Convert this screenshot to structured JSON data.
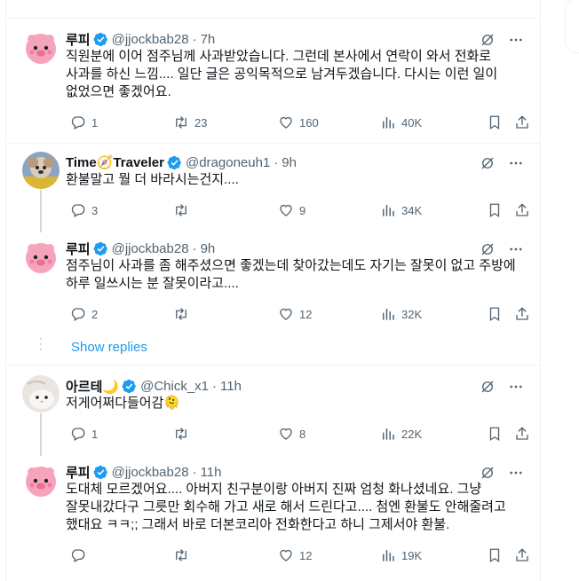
{
  "tweets": [
    {
      "name": "루피",
      "handle": "@jjockbab28",
      "time": "7h",
      "text": "직원분에 이어 점주님께 사과받았습니다. 그런데 본사에서 연락이 와서 전화로 사과를 하신 느낌.... 일단 글은 공익목적으로 남겨두겠습니다. 다시는 이런 일이 없었으면 좋겠어요.",
      "replies": "1",
      "retweets": "23",
      "likes": "160",
      "views": "40K"
    },
    {
      "name": "Time",
      "name_emoji": "🧭",
      "name2": "Traveler",
      "handle": "@dragoneuh1",
      "time": "9h",
      "text": "환불말고 뭘 더 바라시는건지....",
      "replies": "3",
      "retweets": "",
      "likes": "9",
      "views": "34K"
    },
    {
      "name": "루피",
      "handle": "@jjockbab28",
      "time": "9h",
      "text": "점주님이 사과를 좀 해주셨으면 좋겠는데 찾아갔는데도 자기는 잘못이 없고 주방에 하루 일쓰시는 분 잘못이라고....",
      "replies": "2",
      "retweets": "",
      "likes": "12",
      "views": "32K"
    },
    {
      "name": "아르테",
      "name_emoji": "🌙",
      "handle": "@Chick_x1",
      "time": "11h",
      "text": "저게어쩌다들어감🫠",
      "replies": "1",
      "retweets": "",
      "likes": "8",
      "views": "22K"
    },
    {
      "name": "루피",
      "handle": "@jjockbab28",
      "time": "11h",
      "text": "도대체 모르겠어요.... 아버지 친구분이랑 아버지 진짜 엄청 화나셨네요. 그냥 잘못내갔다구 그릇만 회수해 가고 새로 해서 드린다고.... 첨엔 환불도 안해줄려고 했대요 ㅋㅋ;; 그래서 바로 더본코리아 전화한다고 하니 그제서야 환불.",
      "replies": "",
      "retweets": "",
      "likes": "12",
      "views": "19K"
    }
  ],
  "show_replies": "Show replies",
  "icons": {
    "verified": "verified-badge-icon",
    "grok": "grok-icon",
    "more": "more-icon",
    "reply": "reply-icon",
    "retweet": "retweet-icon",
    "like": "like-icon",
    "views": "views-icon",
    "bookmark": "bookmark-icon",
    "share": "share-icon"
  },
  "colors": {
    "accent": "#1d9bf0",
    "muted": "#536471",
    "text": "#0f1419",
    "border": "#eff3f4"
  }
}
